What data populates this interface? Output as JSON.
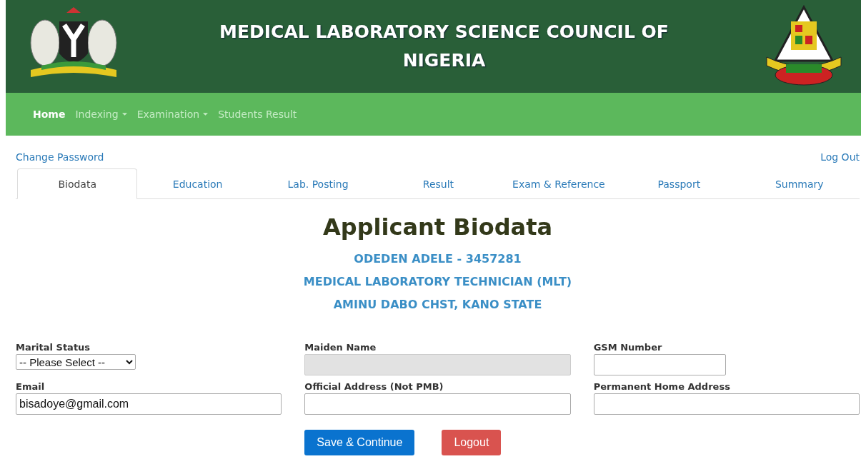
{
  "header": {
    "title_lines": [
      "MEDICAL LABORATORY SCIENCE COUNCIL OF",
      "NIGERIA"
    ]
  },
  "nav": [
    {
      "label": "Home",
      "selected": true,
      "dropdown": false
    },
    {
      "label": "Indexing",
      "selected": false,
      "dropdown": true
    },
    {
      "label": "Examination",
      "selected": false,
      "dropdown": true
    },
    {
      "label": "Students Result",
      "selected": false,
      "dropdown": false
    }
  ],
  "account_links": {
    "left": "Change Password",
    "right": "Log Out"
  },
  "tabs": [
    {
      "label": "Biodata",
      "selected": true
    },
    {
      "label": "Education",
      "selected": false
    },
    {
      "label": "Lab. Posting",
      "selected": false
    },
    {
      "label": "Result",
      "selected": false
    },
    {
      "label": "Exam & Reference",
      "selected": false
    },
    {
      "label": "Passport",
      "selected": false
    },
    {
      "label": "Summary",
      "selected": false
    }
  ],
  "heading": "Applicant Biodata",
  "subtitles": [
    "ODEDEN ADELE - 3457281",
    "MEDICAL LABORATORY TECHNICIAN (MLT)",
    "AMINU DABO CHST, KANO STATE"
  ],
  "fields": [
    {
      "label": "Marital Status",
      "kind": "select",
      "value": "-- Please Select --",
      "disabled": false
    },
    {
      "label": "Maiden Name",
      "kind": "text",
      "disabled": true
    },
    {
      "label": "GSM Number",
      "kind": "short",
      "disabled": false
    },
    {
      "label": "Email",
      "kind": "text",
      "value": "bisadoye@gmail.com",
      "disabled": false
    },
    {
      "label": "Official Address (Not PMB)",
      "kind": "text",
      "disabled": false
    },
    {
      "label": "Permanent Home Address",
      "kind": "text",
      "disabled": false
    }
  ],
  "buttons": [
    {
      "label": "Save & Continue",
      "kind": "primary"
    },
    {
      "label": "Logout",
      "kind": "danger"
    }
  ]
}
